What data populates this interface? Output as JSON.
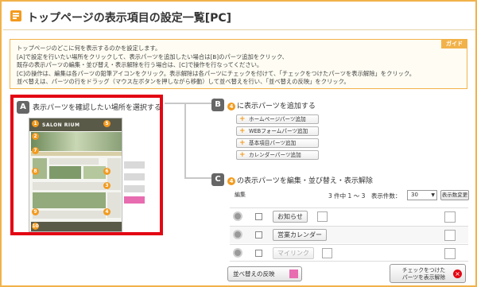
{
  "page": {
    "title": "トップページの表示項目の設定一覧[PC]"
  },
  "guide": {
    "tab_label": "ガイド",
    "lines": [
      "トップページのどこに何を表示するのかを設定します。",
      "[A]で設定を行いたい場所をクリックして、表示パーツを追加したい場合は[B]のパーツ追加をクリック、",
      "既存の表示パーツの編集・並び替え・表示解除を行う場合は、[C]で操作を行なってください。",
      "[C]の操作は、編集は各パーツの鉛筆アイコンをクリック。表示解除は各パーツにチェックを付けて、「チェックをつけたパーツを表示解除」をクリック。",
      "並べ替えは、パーツの行をドラッグ（マウス左ボタンを押しながら移動）して並べ替えを行い、「並べ替えの反映」をクリック。"
    ]
  },
  "section_a": {
    "badge": "A",
    "label": "表示パーツを確認したい場所を選択する",
    "thumbnail_logo": "SALON RIUM",
    "areas": [
      "1",
      "2",
      "3",
      "4",
      "5",
      "6",
      "7",
      "8",
      "9",
      "10"
    ]
  },
  "section_b": {
    "badge": "B",
    "area_num": "4",
    "label": "に表示パーツを追加する",
    "buttons": [
      "ホームページパーツ追加",
      "WEBフォームパーツ追加",
      "基本項目パーツ追加",
      "カレンダーパーツ追加"
    ]
  },
  "section_c": {
    "badge": "C",
    "area_num": "4",
    "label": "の表示パーツを編集・並び替え・表示解除",
    "edit_header": "編集",
    "count_text": "3 件中 1 ～ 3　表示件数：",
    "per_page": "30",
    "per_page_button": "表示数変更",
    "rows": [
      {
        "name": "お知らせ"
      },
      {
        "name": "営業カレンダー"
      },
      {
        "name": "マイリンク"
      }
    ],
    "reorder_button": "並べ替えの反映",
    "hide_button_line1": "チェックをつけた",
    "hide_button_line2": "パーツを表示解除"
  },
  "colors": {
    "accent": "#f39a1e",
    "frame": "#f2b24a",
    "highlight": "#e30613"
  }
}
